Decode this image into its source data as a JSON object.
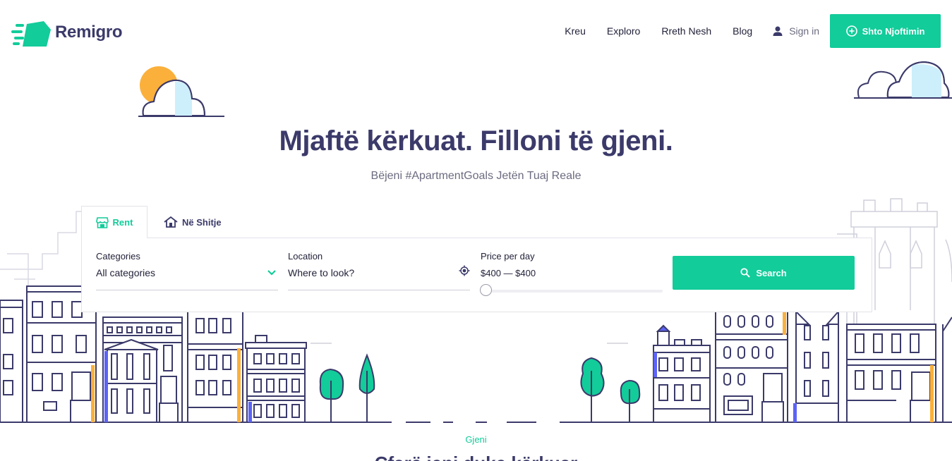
{
  "brand": {
    "name": "Remigro",
    "accent": "#12cc9a",
    "text_color": "#3b3a6a"
  },
  "nav": {
    "items": [
      {
        "label": "Kreu"
      },
      {
        "label": "Exploro"
      },
      {
        "label": "Rreth Nesh"
      },
      {
        "label": "Blog"
      }
    ],
    "signin_label": "Sign in",
    "signin_icon": "user-icon",
    "cta_label": "Shto Njoftimin",
    "cta_icon": "plus-circle-icon"
  },
  "hero": {
    "title": "Mjaftë kërkuat. Filloni të gjeni.",
    "subtitle": "Bëjeni #ApartmentGoals Jetën Tuaj Reale"
  },
  "search": {
    "tabs": [
      {
        "label": "Rent",
        "icon": "store-icon",
        "active": true
      },
      {
        "label": "Në Shitje",
        "icon": "house-icon",
        "active": false
      }
    ],
    "categories": {
      "label": "Categories",
      "value": "All categories",
      "icon": "chevron-down-icon"
    },
    "location": {
      "label": "Location",
      "placeholder": "Where to look?",
      "icon": "locate-icon"
    },
    "price": {
      "label": "Price per day",
      "value": "$400 — $400"
    },
    "button_label": "Search",
    "button_icon": "search-icon"
  },
  "section": {
    "tag": "Gjeni",
    "title": "Çfarë jeni duke kërkuar"
  }
}
